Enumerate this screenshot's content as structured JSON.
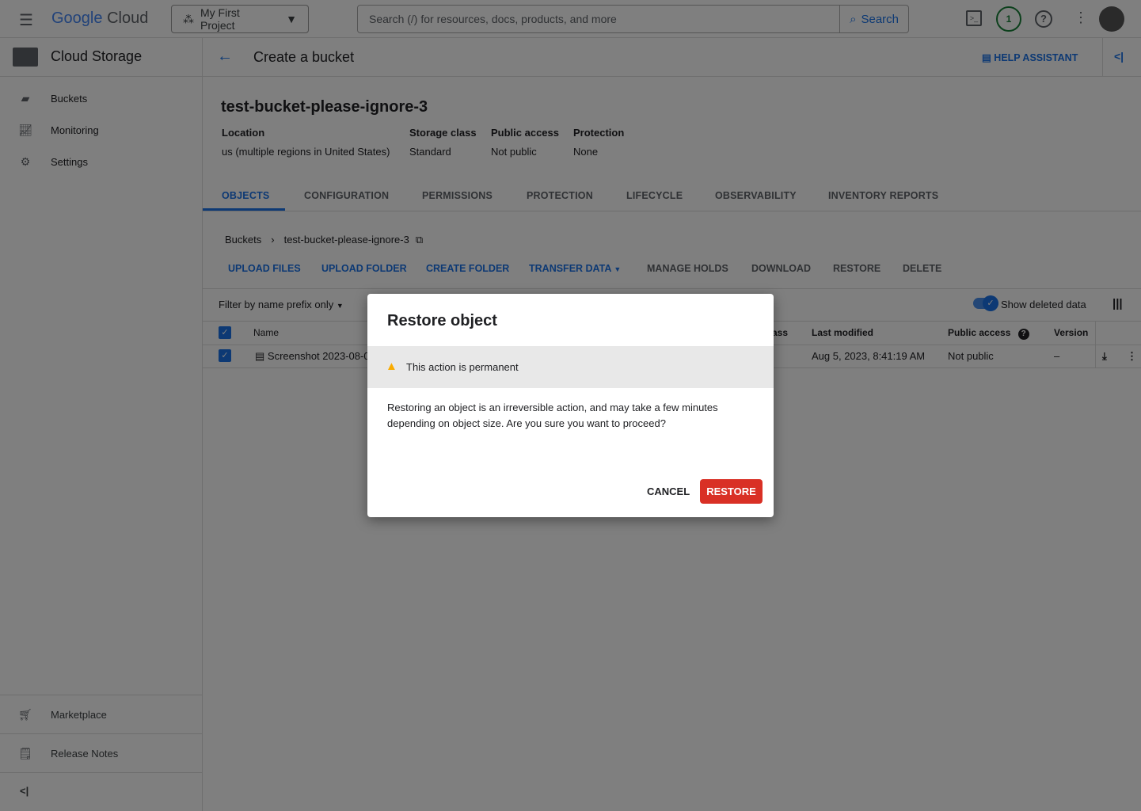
{
  "topbar": {
    "logo_google": "Google",
    "logo_cloud": "Cloud",
    "project": "My First Project",
    "search_placeholder": "Search (/) for resources, docs, products, and more",
    "search_button": "Search",
    "notifications_count": "1"
  },
  "sidebar": {
    "title": "Cloud Storage",
    "items": [
      {
        "label": "Buckets",
        "icon": "bucket-icon"
      },
      {
        "label": "Monitoring",
        "icon": "chart-icon"
      },
      {
        "label": "Settings",
        "icon": "gear-icon"
      }
    ],
    "bottom": [
      {
        "label": "Marketplace",
        "icon": "cart-icon"
      },
      {
        "label": "Release Notes",
        "icon": "notes-icon"
      }
    ]
  },
  "header": {
    "title": "Create a bucket",
    "help": "HELP ASSISTANT"
  },
  "bucket": {
    "name": "test-bucket-please-ignore-3",
    "fields": [
      {
        "label": "Location",
        "value": "us (multiple regions in United States)"
      },
      {
        "label": "Storage class",
        "value": "Standard"
      },
      {
        "label": "Public access",
        "value": "Not public"
      },
      {
        "label": "Protection",
        "value": "None"
      }
    ]
  },
  "tabs": [
    "OBJECTS",
    "CONFIGURATION",
    "PERMISSIONS",
    "PROTECTION",
    "LIFECYCLE",
    "OBSERVABILITY",
    "INVENTORY REPORTS"
  ],
  "breadcrumb": [
    "Buckets",
    "test-bucket-please-ignore-3"
  ],
  "actions": [
    "UPLOAD FILES",
    "UPLOAD FOLDER",
    "CREATE FOLDER",
    "TRANSFER DATA",
    "MANAGE HOLDS",
    "DOWNLOAD",
    "RESTORE",
    "DELETE"
  ],
  "filter": {
    "label": "Filter by name prefix only",
    "toggle_label": "Show deleted data",
    "toggle_on": true
  },
  "table": {
    "headers": [
      "Name",
      "ass",
      "Last modified",
      "Public access",
      "Version"
    ],
    "row": {
      "name": "Screenshot 2023-08-0",
      "modified": "Aug 5, 2023, 8:41:19 AM",
      "public": "Not public",
      "version": "–"
    }
  },
  "dialog": {
    "title": "Restore object",
    "warning": "This action is permanent",
    "body": "Restoring an object is an irreversible action, and may take a few minutes depending on object size. Are you sure you want to proceed?",
    "cancel": "CANCEL",
    "confirm": "RESTORE"
  },
  "colors": {
    "accent": "#1a73e8",
    "danger": "#d93025",
    "warning": "#f9ab00"
  }
}
